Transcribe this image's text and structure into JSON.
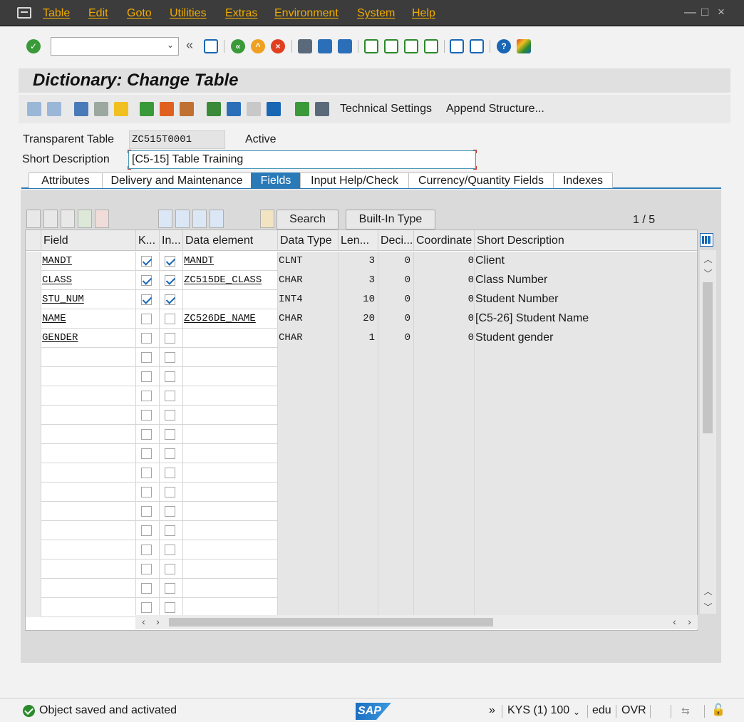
{
  "menu": [
    "Table",
    "Edit",
    "Goto",
    "Utilities",
    "Extras",
    "Environment",
    "System",
    "Help"
  ],
  "window_controls": [
    "—",
    "□",
    "×"
  ],
  "toolbar": {
    "back_glyph": "«"
  },
  "title": "Dictionary: Change Table",
  "app_toolbar": {
    "technical_settings": "Technical Settings",
    "append_structure": "Append Structure..."
  },
  "header": {
    "transparent_table_label": "Transparent Table",
    "table_name": "ZC515T0001",
    "status": "Active",
    "short_description_label": "Short Description",
    "short_description_value": "[C5-15] Table Training"
  },
  "tabs": [
    {
      "label": "Attributes",
      "active": false
    },
    {
      "label": "Delivery and Maintenance",
      "active": false
    },
    {
      "label": "Fields",
      "active": true
    },
    {
      "label": "Input Help/Check",
      "active": false
    },
    {
      "label": "Currency/Quantity Fields",
      "active": false
    },
    {
      "label": "Indexes",
      "active": false
    }
  ],
  "fields_toolbar": {
    "search": "Search",
    "builtin_type": "Built-In Type",
    "pager": "1 / 5"
  },
  "table": {
    "columns": [
      "Field",
      "K...",
      "In...",
      "Data element",
      "Data Type",
      "Len...",
      "Deci...",
      "Coordinate",
      "Short Description"
    ],
    "rows": [
      {
        "field": "MANDT",
        "key": true,
        "initial": true,
        "data_element": "MANDT",
        "data_type": "CLNT",
        "length": "3",
        "decimals": "0",
        "coordinate": "0",
        "description": "Client"
      },
      {
        "field": "CLASS",
        "key": true,
        "initial": true,
        "data_element": "ZC515DE_CLASS",
        "data_type": "CHAR",
        "length": "3",
        "decimals": "0",
        "coordinate": "0",
        "description": "Class Number"
      },
      {
        "field": "STU_NUM",
        "key": true,
        "initial": true,
        "data_element": "",
        "data_type": "INT4",
        "length": "10",
        "decimals": "0",
        "coordinate": "0",
        "description": "Student Number"
      },
      {
        "field": "NAME",
        "key": false,
        "initial": false,
        "data_element": "ZC526DE_NAME",
        "data_type": "CHAR",
        "length": "20",
        "decimals": "0",
        "coordinate": "0",
        "description": "[C5-26] Student Name"
      },
      {
        "field": "GENDER",
        "key": false,
        "initial": false,
        "data_element": "",
        "data_type": "CHAR",
        "length": "1",
        "decimals": "0",
        "coordinate": "0",
        "description": "Student gender"
      }
    ],
    "empty_rows": 14
  },
  "status_bar": {
    "message": "Object saved and activated",
    "logo": "SAP",
    "chevrons": "»",
    "system": "KYS (1) 100",
    "host": "edu",
    "mode": "OVR"
  },
  "colors": {
    "menu_text": "#f0ab00",
    "active_tab": "#2a7ab8",
    "ok_green": "#2b8a2b"
  }
}
